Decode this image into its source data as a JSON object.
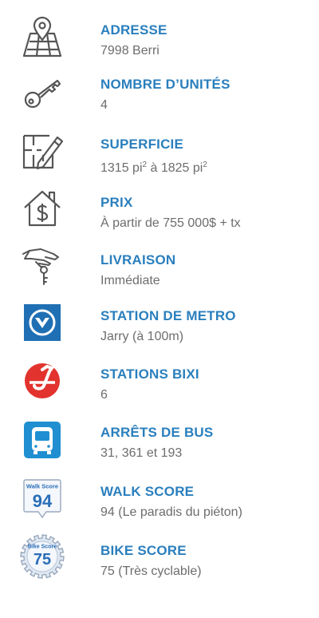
{
  "colors": {
    "label": "#2a7fbd",
    "value": "#6d6d6d",
    "icon_outline": "#555555",
    "metro_blue": "#1f6fb4",
    "bixi_red": "#e2332e",
    "bus_blue": "#1f8fd1",
    "walkscore_blue": "#2a6eb8"
  },
  "items": [
    {
      "icon": "map-pin-icon",
      "label": "ADRESSE",
      "value": "7998 Berri"
    },
    {
      "icon": "key-icon",
      "label": "NOMBRE D’UNITÉS",
      "value": "4"
    },
    {
      "icon": "floorplan-pencil-icon",
      "label": "SUPERFICIE",
      "value_parts": [
        "1315 pi",
        "2",
        " à 1825 pi",
        "2"
      ]
    },
    {
      "icon": "house-dollar-icon",
      "label": "PRIX",
      "value": "À partir de 755 000$ + tx"
    },
    {
      "icon": "hand-keys-icon",
      "label": "LIVRAISON",
      "value": "Immédiate"
    },
    {
      "icon": "metro-icon",
      "label": "STATION DE METRO",
      "value": "Jarry (à 100m)"
    },
    {
      "icon": "bixi-icon",
      "label": "STATIONS BIXI",
      "value": "6"
    },
    {
      "icon": "bus-icon",
      "label": "ARRÊTS DE BUS",
      "value": "31, 361 et 193"
    },
    {
      "icon": "walk-score-badge-icon",
      "label": "WALK SCORE",
      "value": "94 (Le paradis du piéton)",
      "badge_title": "Walk Score",
      "badge_number": "94"
    },
    {
      "icon": "bike-score-badge-icon",
      "label": "BIKE SCORE",
      "value": "75 (Très cyclable)",
      "badge_title": "Bike Score",
      "badge_number": "75"
    }
  ]
}
